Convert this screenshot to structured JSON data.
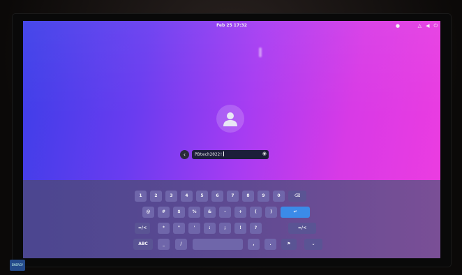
{
  "topbar": {
    "clock": "Feb 25 17:32"
  },
  "login": {
    "password_value": "PBtech2022!"
  },
  "keyboard": {
    "row1": [
      "1",
      "2",
      "3",
      "4",
      "5",
      "6",
      "7",
      "8",
      "9",
      "0"
    ],
    "row2": [
      "@",
      "#",
      "$",
      "%",
      "&",
      "-",
      "+",
      "(",
      ")"
    ],
    "row3_left": "=/<",
    "row3": [
      "*",
      "\"",
      "'",
      ":",
      ";",
      "!",
      "?"
    ],
    "row3_right": "=/<",
    "row4": {
      "abc": "ABC",
      "underscore": "_",
      "slash": "/",
      "comma": ",",
      "period": "."
    }
  },
  "colors": {
    "enter_key": "#3b8be8",
    "key": "#6f66aa"
  }
}
